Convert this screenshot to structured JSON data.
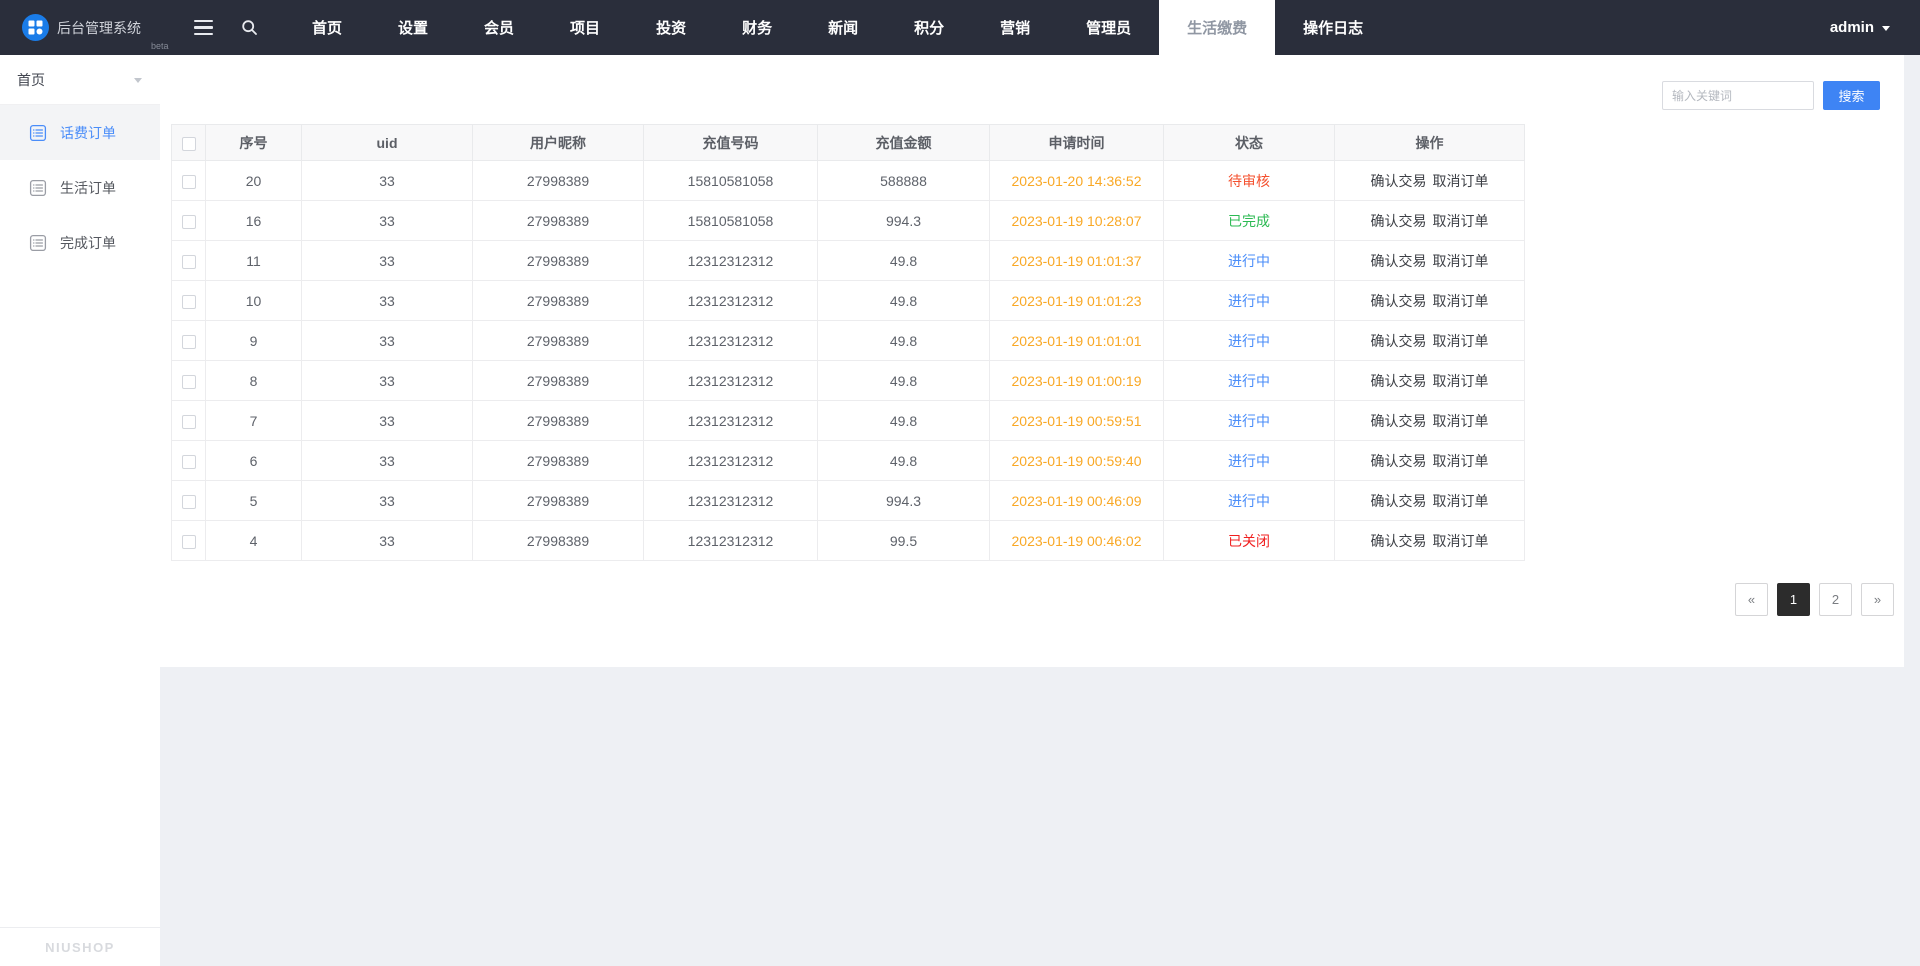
{
  "topbar": {
    "logo": {
      "text": "后台管理系统",
      "badge": "beta"
    },
    "nav_items": [
      {
        "label": "首页",
        "active": false
      },
      {
        "label": "设置",
        "active": false
      },
      {
        "label": "会员",
        "active": false
      },
      {
        "label": "项目",
        "active": false
      },
      {
        "label": "投资",
        "active": false
      },
      {
        "label": "财务",
        "active": false
      },
      {
        "label": "新闻",
        "active": false
      },
      {
        "label": "积分",
        "active": false
      },
      {
        "label": "营销",
        "active": false
      },
      {
        "label": "管理员",
        "active": false
      },
      {
        "label": "生活缴费",
        "active": true
      },
      {
        "label": "操作日志",
        "active": false
      }
    ],
    "user": {
      "name": "admin"
    }
  },
  "sidebar": {
    "section": "首页",
    "items": [
      {
        "label": "话费订单",
        "active": true
      },
      {
        "label": "生活订单",
        "active": false
      },
      {
        "label": "完成订单",
        "active": false
      }
    ],
    "footer_brand": "NIUSHOP"
  },
  "toolbar": {
    "search_placeholder": "输入关键词",
    "search_button": "搜索"
  },
  "table": {
    "headers": [
      "序号",
      "uid",
      "用户昵称",
      "充值号码",
      "充值金额",
      "申请时间",
      "状态",
      "操作"
    ],
    "actions": [
      "确认交易",
      "取消订单"
    ],
    "rows": [
      {
        "seq": "20",
        "uid": "33",
        "nickname": "27998389",
        "number": "15810581058",
        "amount": "588888",
        "time": "2023-01-20 14:36:52",
        "status": "待审核"
      },
      {
        "seq": "16",
        "uid": "33",
        "nickname": "27998389",
        "number": "15810581058",
        "amount": "994.3",
        "time": "2023-01-19 10:28:07",
        "status": "已完成"
      },
      {
        "seq": "11",
        "uid": "33",
        "nickname": "27998389",
        "number": "12312312312",
        "amount": "49.8",
        "time": "2023-01-19 01:01:37",
        "status": "进行中"
      },
      {
        "seq": "10",
        "uid": "33",
        "nickname": "27998389",
        "number": "12312312312",
        "amount": "49.8",
        "time": "2023-01-19 01:01:23",
        "status": "进行中"
      },
      {
        "seq": "9",
        "uid": "33",
        "nickname": "27998389",
        "number": "12312312312",
        "amount": "49.8",
        "time": "2023-01-19 01:01:01",
        "status": "进行中"
      },
      {
        "seq": "8",
        "uid": "33",
        "nickname": "27998389",
        "number": "12312312312",
        "amount": "49.8",
        "time": "2023-01-19 01:00:19",
        "status": "进行中"
      },
      {
        "seq": "7",
        "uid": "33",
        "nickname": "27998389",
        "number": "12312312312",
        "amount": "49.8",
        "time": "2023-01-19 00:59:51",
        "status": "进行中"
      },
      {
        "seq": "6",
        "uid": "33",
        "nickname": "27998389",
        "number": "12312312312",
        "amount": "49.8",
        "time": "2023-01-19 00:59:40",
        "status": "进行中"
      },
      {
        "seq": "5",
        "uid": "33",
        "nickname": "27998389",
        "number": "12312312312",
        "amount": "994.3",
        "time": "2023-01-19 00:46:09",
        "status": "进行中"
      },
      {
        "seq": "4",
        "uid": "33",
        "nickname": "27998389",
        "number": "12312312312",
        "amount": "99.5",
        "time": "2023-01-19 00:46:02",
        "status": "已关闭"
      }
    ]
  },
  "pagination": {
    "prev": "«",
    "pages": [
      {
        "label": "1",
        "active": true
      },
      {
        "label": "2",
        "active": false
      }
    ],
    "next": "»"
  },
  "colors": {
    "accent_blue": "#3e84f4",
    "topbar_bg": "#2a2e3b",
    "time_text": "#f9a825",
    "status": {
      "待审核": "#f4502e",
      "已完成": "#2cba53",
      "进行中": "#4a8df9",
      "已关闭": "#f01f1f"
    }
  }
}
